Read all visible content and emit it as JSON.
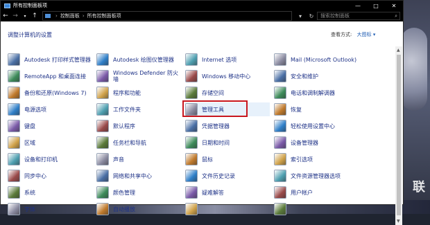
{
  "window": {
    "title": "所有控制面板项",
    "controls": {
      "min": "—",
      "max": "□",
      "close": "✕"
    }
  },
  "address": {
    "back": "←",
    "forward": "→",
    "up": "↑",
    "path": [
      "控制面板",
      "所有控制面板项"
    ],
    "search_placeholder": "搜索控制面板"
  },
  "content": {
    "heading": "调整计算机的设置",
    "view_by_label": "查看方式:",
    "view_by_value": "大图标 ▾"
  },
  "items": [
    [
      {
        "label": "Autodesk 打印样式管理器",
        "icon": "printer-icon"
      },
      {
        "label": "RemoteApp 和桌面连接",
        "icon": "remote-desktop-icon"
      },
      {
        "label": "备份和还原(Windows 7)",
        "icon": "backup-icon"
      },
      {
        "label": "电源选项",
        "icon": "power-icon"
      },
      {
        "label": "键盘",
        "icon": "keyboard-icon"
      },
      {
        "label": "区域",
        "icon": "globe-icon"
      },
      {
        "label": "设备和打印机",
        "icon": "devices-icon"
      },
      {
        "label": "同步中心",
        "icon": "sync-icon"
      },
      {
        "label": "系统",
        "icon": "system-icon"
      },
      {
        "label": "字体",
        "icon": "font-icon"
      }
    ],
    [
      {
        "label": "Autodesk 绘图仪管理器",
        "icon": "plotter-icon"
      },
      {
        "label": "Windows Defender 防火墙",
        "icon": "firewall-icon"
      },
      {
        "label": "程序和功能",
        "icon": "programs-icon"
      },
      {
        "label": "工作文件夹",
        "icon": "folder-icon"
      },
      {
        "label": "默认程序",
        "icon": "default-programs-icon"
      },
      {
        "label": "任务栏和导航",
        "icon": "taskbar-icon"
      },
      {
        "label": "声音",
        "icon": "sound-icon"
      },
      {
        "label": "网络和共享中心",
        "icon": "network-icon"
      },
      {
        "label": "颜色管理",
        "icon": "color-icon"
      },
      {
        "label": "自动播放",
        "icon": "autoplay-icon"
      }
    ],
    [
      {
        "label": "Internet 选项",
        "icon": "internet-icon"
      },
      {
        "label": "Windows 移动中心",
        "icon": "mobility-icon"
      },
      {
        "label": "存储空间",
        "icon": "storage-icon"
      },
      {
        "label": "管理工具",
        "icon": "admin-tools-icon"
      },
      {
        "label": "凭据管理器",
        "icon": "credential-icon"
      },
      {
        "label": "日期和时间",
        "icon": "clock-icon"
      },
      {
        "label": "鼠标",
        "icon": "mouse-icon"
      },
      {
        "label": "文件历史记录",
        "icon": "file-history-icon"
      },
      {
        "label": "疑难解答",
        "icon": "troubleshoot-icon"
      },
      {
        "label": "",
        "icon": "misc-icon"
      }
    ],
    [
      {
        "label": "Mail (Microsoft Outlook)",
        "icon": "mail-icon"
      },
      {
        "label": "安全和维护",
        "icon": "flag-icon"
      },
      {
        "label": "电话和调制解调器",
        "icon": "phone-icon"
      },
      {
        "label": "恢复",
        "icon": "recovery-icon"
      },
      {
        "label": "轻松使用设置中心",
        "icon": "ease-icon"
      },
      {
        "label": "设备管理器",
        "icon": "device-manager-icon"
      },
      {
        "label": "索引选项",
        "icon": "index-icon"
      },
      {
        "label": "文件资源管理器选项",
        "icon": "explorer-icon"
      },
      {
        "label": "用户帐户",
        "icon": "user-icon"
      },
      {
        "label": "",
        "icon": "misc2-icon"
      }
    ]
  ],
  "watermark": "联",
  "colors": {
    "accent": "#1e3287",
    "highlight_border": "#c8161d",
    "titlebar": "#000000"
  }
}
